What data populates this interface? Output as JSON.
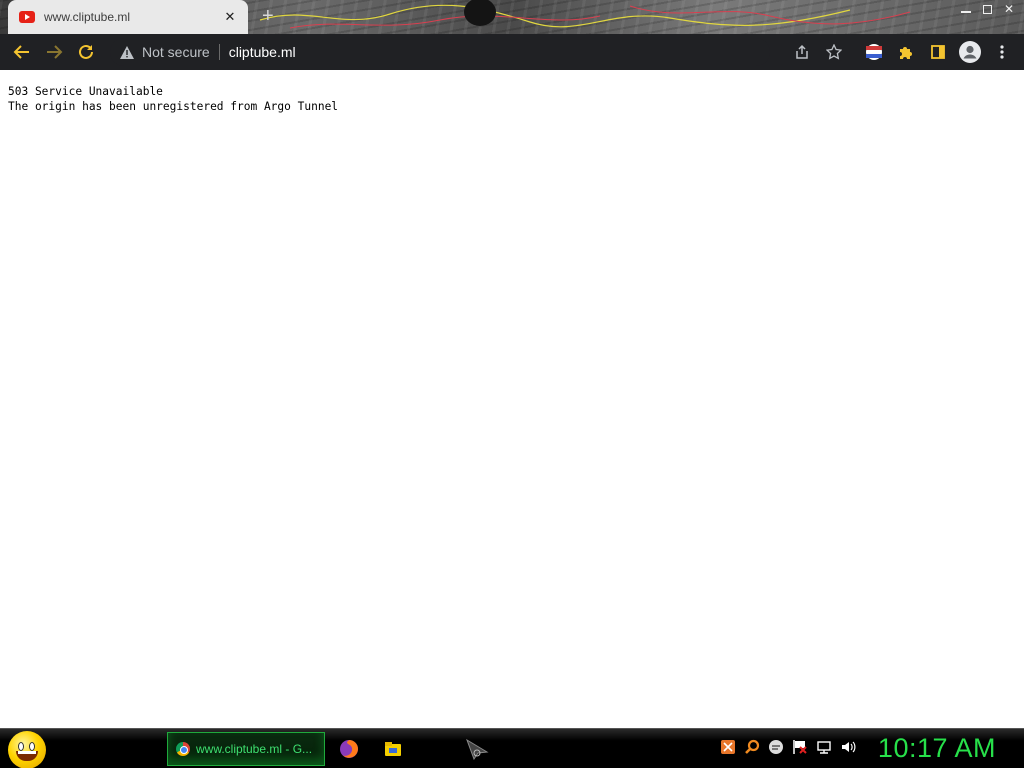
{
  "browser": {
    "tab": {
      "title": "www.cliptube.ml",
      "favicon": "youtube-favicon-icon",
      "close_glyph": "✕"
    },
    "new_tab_glyph": "+",
    "window_controls": {
      "close_glyph": "✕"
    },
    "toolbar": {
      "back_icon": "arrow-left-icon",
      "forward_icon": "arrow-right-icon",
      "reload_icon": "reload-icon",
      "security_label": "Not secure",
      "url": "cliptube.ml",
      "accent": "#f4c430"
    }
  },
  "page": {
    "line1": "503 Service Unavailable",
    "line2": "The origin has been unregistered from Argo Tunnel"
  },
  "taskbar": {
    "active_window_label": "www.cliptube.ml - G...",
    "clock": "10:17 AM",
    "clock_color": "#27e04a",
    "pinned": [
      "firefox-icon",
      "file-explorer-icon",
      "cursor-app-icon"
    ],
    "tray": [
      "antivirus-icon",
      "search-icon",
      "chat-icon",
      "action-center-flag-icon",
      "network-icon",
      "volume-icon"
    ]
  }
}
